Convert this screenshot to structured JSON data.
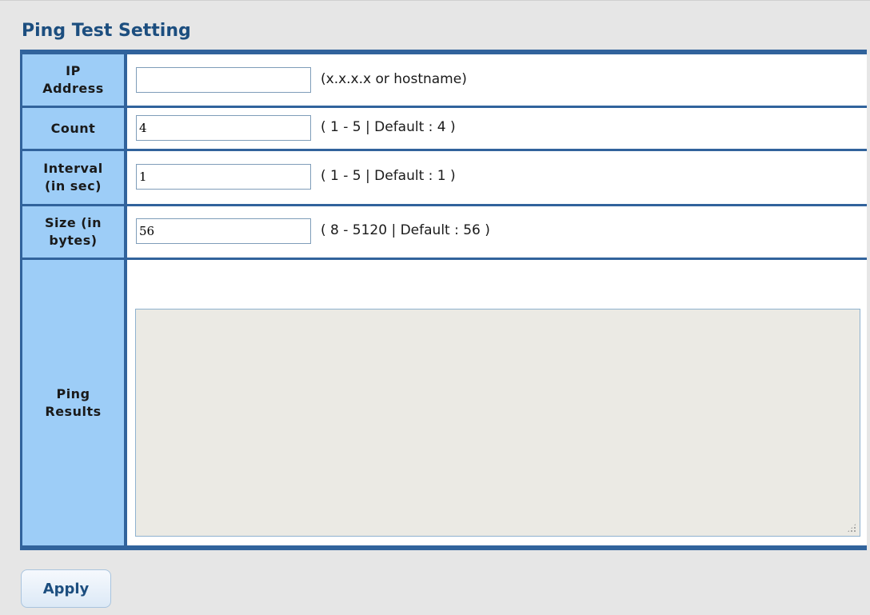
{
  "page": {
    "title": "Ping Test Setting"
  },
  "form": {
    "ip_address": {
      "label_line1": "IP",
      "label_line2": "Address",
      "value": "",
      "hint": "(x.x.x.x or hostname)"
    },
    "count": {
      "label_line1": "Count",
      "value": "4",
      "hint": "( 1 - 5 | Default : 4 )"
    },
    "interval": {
      "label_line1": "Interval",
      "label_line2": "(in sec)",
      "value": "1",
      "hint": "( 1 - 5 | Default : 1 )"
    },
    "size": {
      "label_line1": "Size (in",
      "label_line2": "bytes)",
      "value": "56",
      "hint": "( 8 - 5120 | Default : 56 )"
    },
    "ping_results": {
      "label_line1": "Ping",
      "label_line2": "Results",
      "value": ""
    }
  },
  "actions": {
    "apply_label": "Apply"
  },
  "colors": {
    "title": "#1c4e7f",
    "label_background": "#9dcdf7",
    "border": "#31639c",
    "results_background": "#ebeae4",
    "page_background": "#e6e6e6"
  }
}
